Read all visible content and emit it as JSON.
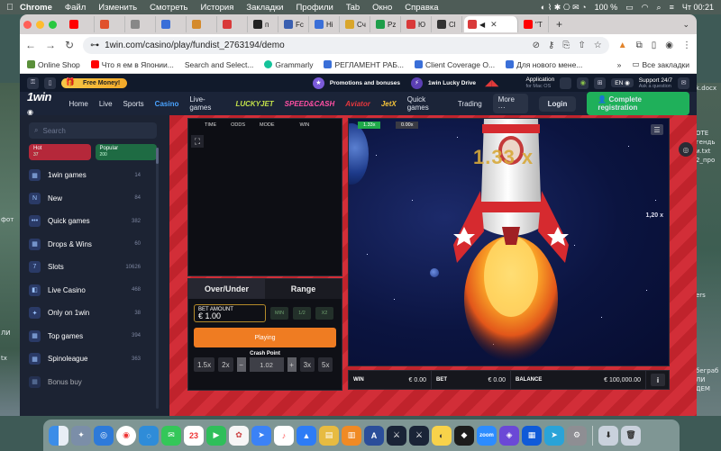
{
  "menubar": {
    "app": "Chrome",
    "items": [
      "Файл",
      "Изменить",
      "Смотреть",
      "История",
      "Закладки",
      "Профили",
      "Tab",
      "Окно",
      "Справка"
    ],
    "battery": "100 %",
    "datetime": "Чт 00:21"
  },
  "tabs": [
    {
      "label": "",
      "color": "#ff0000"
    },
    {
      "label": "",
      "color": "#e0522d"
    },
    {
      "label": "",
      "color": "#888888"
    },
    {
      "label": "",
      "color": "#3a6fd8"
    },
    {
      "label": "",
      "color": "#d48a2c"
    },
    {
      "label": "",
      "color": "#d93a3a"
    },
    {
      "label": "п",
      "color": "#222222"
    },
    {
      "label": "Fc",
      "color": "#3a5fb0"
    },
    {
      "label": "Hi",
      "color": "#3a6fd8"
    },
    {
      "label": "Cч",
      "color": "#d9a62c"
    },
    {
      "label": "Pz",
      "color": "#1e9e4a"
    },
    {
      "label": "Ю",
      "color": "#d93a3a"
    },
    {
      "label": "Cl",
      "color": "#333333"
    },
    {
      "label": "",
      "color": "#d93a3a"
    },
    {
      "label": "",
      "color": "#ff0000"
    },
    {
      "label": "\"Т",
      "color": "#ff0000"
    }
  ],
  "address": {
    "url": "1win.com/casino/play/fundist_2763194/demo"
  },
  "bookmarks": [
    {
      "label": "Online Shop",
      "color": "#5a8f3a"
    },
    {
      "label": "Что я ем в Японии...",
      "color": "#ff0000"
    },
    {
      "label": "Search and Select...",
      "color": ""
    },
    {
      "label": "Grammarly",
      "color": "#15c39a"
    },
    {
      "label": "РЕГЛАМЕНТ РАБ...",
      "color": "#3a6fd8"
    },
    {
      "label": "Client Coverage O...",
      "color": "#3a6fd8"
    },
    {
      "label": "Для нового мене...",
      "color": "#3a6fd8"
    }
  ],
  "bookmarks_all": "Все закладки",
  "site": {
    "free_money": "Free Money!",
    "promotions": "Promotions and bonuses",
    "lucky_drive": "1win Lucky Drive",
    "application": "Application",
    "application_sub": "for Mac OS",
    "lang": "EN",
    "support": "Support 24/7",
    "support_sub": "Ask a question",
    "logo": "1win",
    "nav": [
      "Home",
      "Live",
      "Sports",
      "Casino",
      "Live-games"
    ],
    "active_nav": "Casino",
    "brands": [
      {
        "label": "LUCKYJET",
        "color": "#c4e34a"
      },
      {
        "label": "SPEED&CASH",
        "color": "#ff4fa3"
      },
      {
        "label": "Aviator",
        "color": "#e8373d"
      },
      {
        "label": "JetX",
        "color": "#f3c23a"
      }
    ],
    "nav2": [
      "Quick games",
      "Trading"
    ],
    "more": "More",
    "login": "Login",
    "register": "Complete registration"
  },
  "sidebar": {
    "search_placeholder": "Search",
    "chips": [
      {
        "label": "Hot",
        "count": "37",
        "color": "#b5283a"
      },
      {
        "label": "Popular",
        "count": "200",
        "color": "#1e6b43"
      }
    ],
    "categories": [
      {
        "label": "1win games",
        "count": "14",
        "icon": "grid-icon"
      },
      {
        "label": "New",
        "count": "84",
        "icon": "new-icon"
      },
      {
        "label": "Quick games",
        "count": "382",
        "icon": "dots-icon"
      },
      {
        "label": "Drops & Wins",
        "count": "60",
        "icon": "grid-icon"
      },
      {
        "label": "Slots",
        "count": "10626",
        "icon": "slots-icon"
      },
      {
        "label": "Live Casino",
        "count": "468",
        "icon": "live-icon"
      },
      {
        "label": "Only on 1win",
        "count": "38",
        "icon": "star-icon"
      },
      {
        "label": "Top games",
        "count": "394",
        "icon": "grid-icon"
      },
      {
        "label": "Spinoleague",
        "count": "363",
        "icon": "grid-icon"
      },
      {
        "label": "Bonus buy",
        "count": "",
        "icon": "grid-icon"
      }
    ]
  },
  "game": {
    "history_headers": [
      "TIME",
      "ODDS",
      "MODE",
      "WIN"
    ],
    "tabs": [
      "Over/Under",
      "Range"
    ],
    "bet_amount_label": "BET AMOUNT",
    "bet_amount": "€ 1.00",
    "quick_buttons": [
      "MIN",
      "1/2",
      "X2"
    ],
    "play": "Playing",
    "crash_point_label": "Crash Point",
    "crash_quick": [
      "1.5x",
      "2x"
    ],
    "crash_value": "1.02",
    "crash_quick2": [
      "3x",
      "5x"
    ],
    "chip_green": "1.33x",
    "chip_gray": "0.00x",
    "big_multiplier": "1.33 x",
    "side_multiplier": "1,20 x",
    "win_label": "WIN",
    "win_value": "€ 0.00",
    "bet_label": "BET",
    "bet_value": "€ 0.00",
    "balance_label": "BALANCE",
    "balance_value": "€ 100,000.00"
  },
  "desktop_labels": [
    "фот",
    "k.docx",
    "ОТЕ",
    "гендь",
    "и.txt",
    "2_про",
    "ЛИ",
    "tx",
    "ers",
    "беграб",
    "ЛИ",
    "ДЕМ"
  ]
}
